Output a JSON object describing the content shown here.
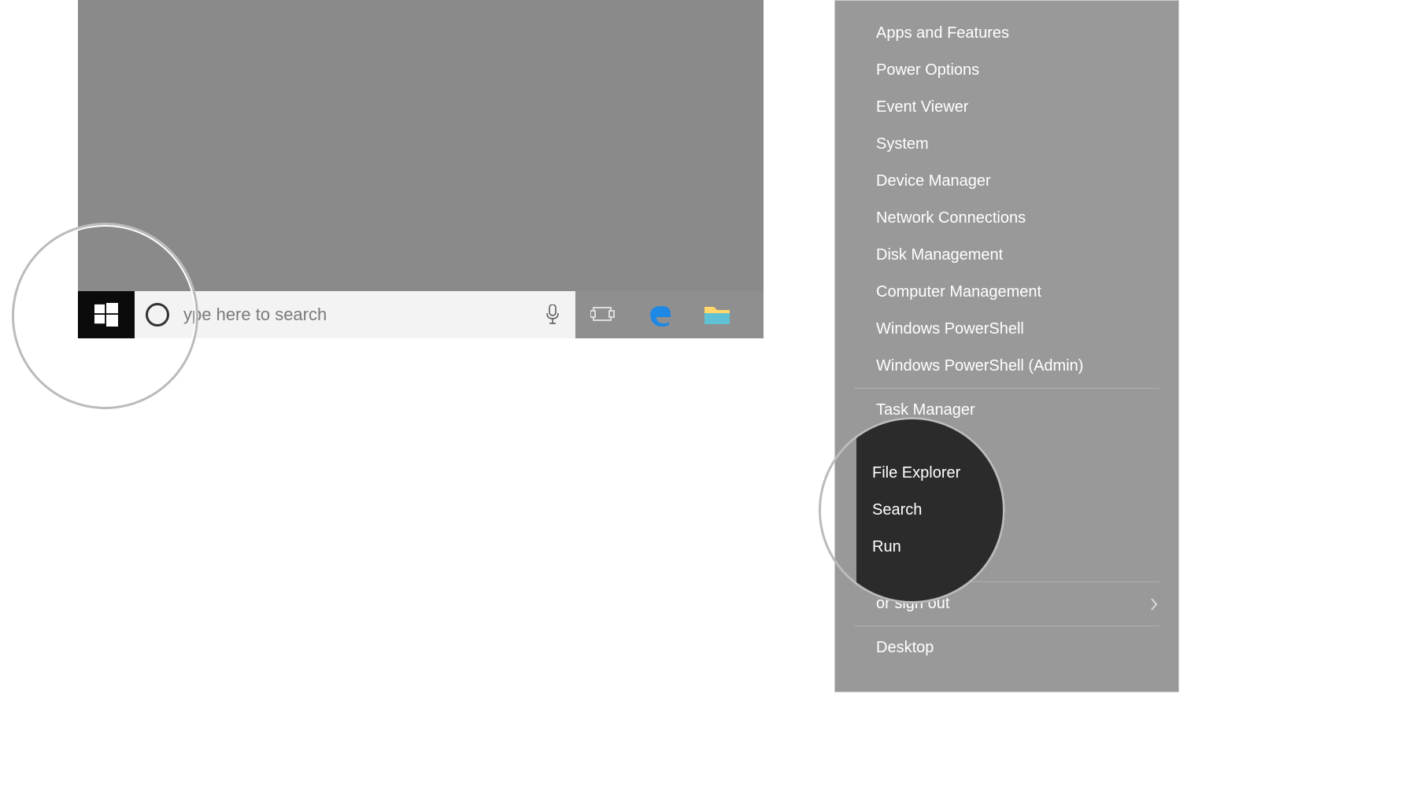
{
  "taskbar": {
    "search_placeholder": "ype here to search"
  },
  "power_menu": {
    "items": [
      "Apps and Features",
      "Power Options",
      "Event Viewer",
      "System",
      "Device Manager",
      "Network Connections",
      "Disk Management",
      "Computer Management",
      "Windows PowerShell",
      "Windows PowerShell (Admin)"
    ],
    "items2": [
      "Task Manager"
    ],
    "signout": "or sign out",
    "desktop": "Desktop"
  },
  "lens_dark": {
    "items": [
      "File Explorer",
      "Search",
      "Run"
    ]
  }
}
